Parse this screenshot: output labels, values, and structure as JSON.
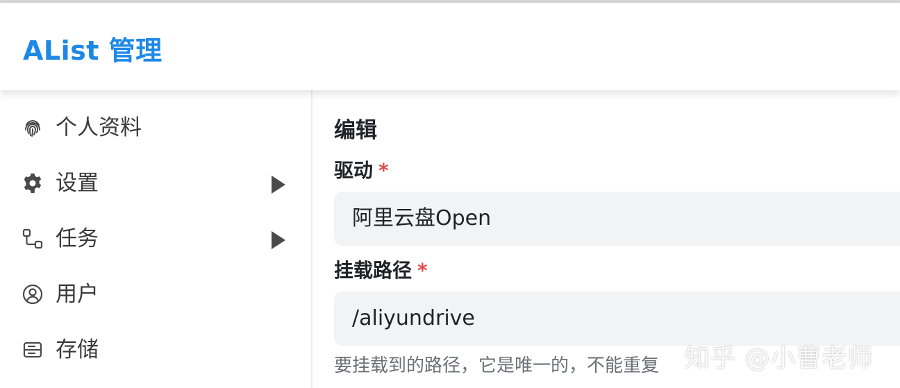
{
  "app": {
    "title": "AList 管理"
  },
  "sidebar": {
    "items": [
      {
        "label": "个人资料",
        "icon": "fingerprint-icon",
        "has_arrow": false
      },
      {
        "label": "设置",
        "icon": "gear-icon",
        "has_arrow": true
      },
      {
        "label": "任务",
        "icon": "workflow-icon",
        "has_arrow": true
      },
      {
        "label": "用户",
        "icon": "user-circle-icon",
        "has_arrow": false
      },
      {
        "label": "存储",
        "icon": "storage-icon",
        "has_arrow": false
      }
    ]
  },
  "main": {
    "section_title": "编辑",
    "driver": {
      "label": "驱动",
      "required_mark": "*",
      "value": "阿里云盘Open"
    },
    "mount_path": {
      "label": "挂载路径",
      "required_mark": "*",
      "value": "/aliyundrive",
      "helper": "要挂载到的路径，它是唯一的，不能重复"
    }
  },
  "watermark": {
    "text": "知乎 @小曹老师"
  },
  "colors": {
    "brand": "#1e88e5",
    "required": "#e5484d",
    "field_bg": "#f1f3f5",
    "helper_text": "#6b6f76"
  }
}
